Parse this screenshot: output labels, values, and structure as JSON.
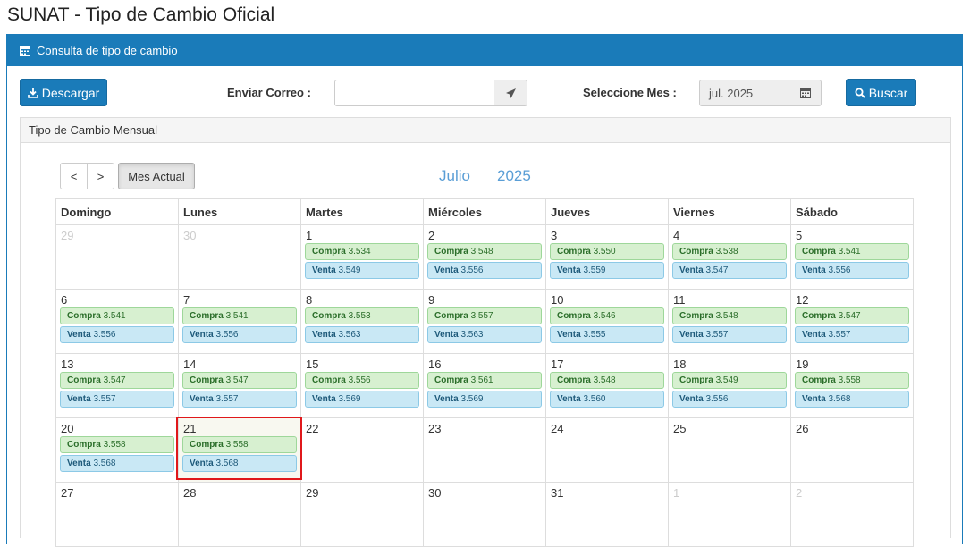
{
  "page": {
    "title": "SUNAT - Tipo de Cambio Oficial"
  },
  "panel": {
    "heading": "Consulta de tipo de cambio"
  },
  "toolbar": {
    "download_label": "Descargar",
    "email_label": "Enviar Correo :",
    "email_value": "",
    "month_label": "Seleccione Mes :",
    "month_value": "jul. 2025",
    "search_label": "Buscar"
  },
  "subpanel": {
    "heading": "Tipo de Cambio Mensual"
  },
  "calendar": {
    "prev": "<",
    "next": ">",
    "today_button": "Mes Actual",
    "month_name": "Julio",
    "year": "2025",
    "weekdays": [
      "Domingo",
      "Lunes",
      "Martes",
      "Miércoles",
      "Jueves",
      "Viernes",
      "Sábado"
    ],
    "compra_label": "Compra",
    "venta_label": "Venta",
    "weeks": [
      [
        {
          "day": "29",
          "other": true
        },
        {
          "day": "30",
          "other": true
        },
        {
          "day": "1",
          "compra": "3.534",
          "venta": "3.549"
        },
        {
          "day": "2",
          "compra": "3.548",
          "venta": "3.556"
        },
        {
          "day": "3",
          "compra": "3.550",
          "venta": "3.559"
        },
        {
          "day": "4",
          "compra": "3.538",
          "venta": "3.547"
        },
        {
          "day": "5",
          "compra": "3.541",
          "venta": "3.556"
        }
      ],
      [
        {
          "day": "6",
          "compra": "3.541",
          "venta": "3.556"
        },
        {
          "day": "7",
          "compra": "3.541",
          "venta": "3.556"
        },
        {
          "day": "8",
          "compra": "3.553",
          "venta": "3.563"
        },
        {
          "day": "9",
          "compra": "3.557",
          "venta": "3.563"
        },
        {
          "day": "10",
          "compra": "3.546",
          "venta": "3.555"
        },
        {
          "day": "11",
          "compra": "3.548",
          "venta": "3.557"
        },
        {
          "day": "12",
          "compra": "3.547",
          "venta": "3.557"
        }
      ],
      [
        {
          "day": "13",
          "compra": "3.547",
          "venta": "3.557"
        },
        {
          "day": "14",
          "compra": "3.547",
          "venta": "3.557"
        },
        {
          "day": "15",
          "compra": "3.556",
          "venta": "3.569"
        },
        {
          "day": "16",
          "compra": "3.561",
          "venta": "3.569"
        },
        {
          "day": "17",
          "compra": "3.548",
          "venta": "3.560"
        },
        {
          "day": "18",
          "compra": "3.549",
          "venta": "3.556"
        },
        {
          "day": "19",
          "compra": "3.558",
          "venta": "3.568"
        }
      ],
      [
        {
          "day": "20",
          "compra": "3.558",
          "venta": "3.568"
        },
        {
          "day": "21",
          "compra": "3.558",
          "venta": "3.568",
          "today": true
        },
        {
          "day": "22"
        },
        {
          "day": "23"
        },
        {
          "day": "24"
        },
        {
          "day": "25"
        },
        {
          "day": "26"
        }
      ],
      [
        {
          "day": "27"
        },
        {
          "day": "28"
        },
        {
          "day": "29"
        },
        {
          "day": "30"
        },
        {
          "day": "31"
        },
        {
          "day": "1",
          "other": true
        },
        {
          "day": "2",
          "other": true
        }
      ]
    ]
  }
}
